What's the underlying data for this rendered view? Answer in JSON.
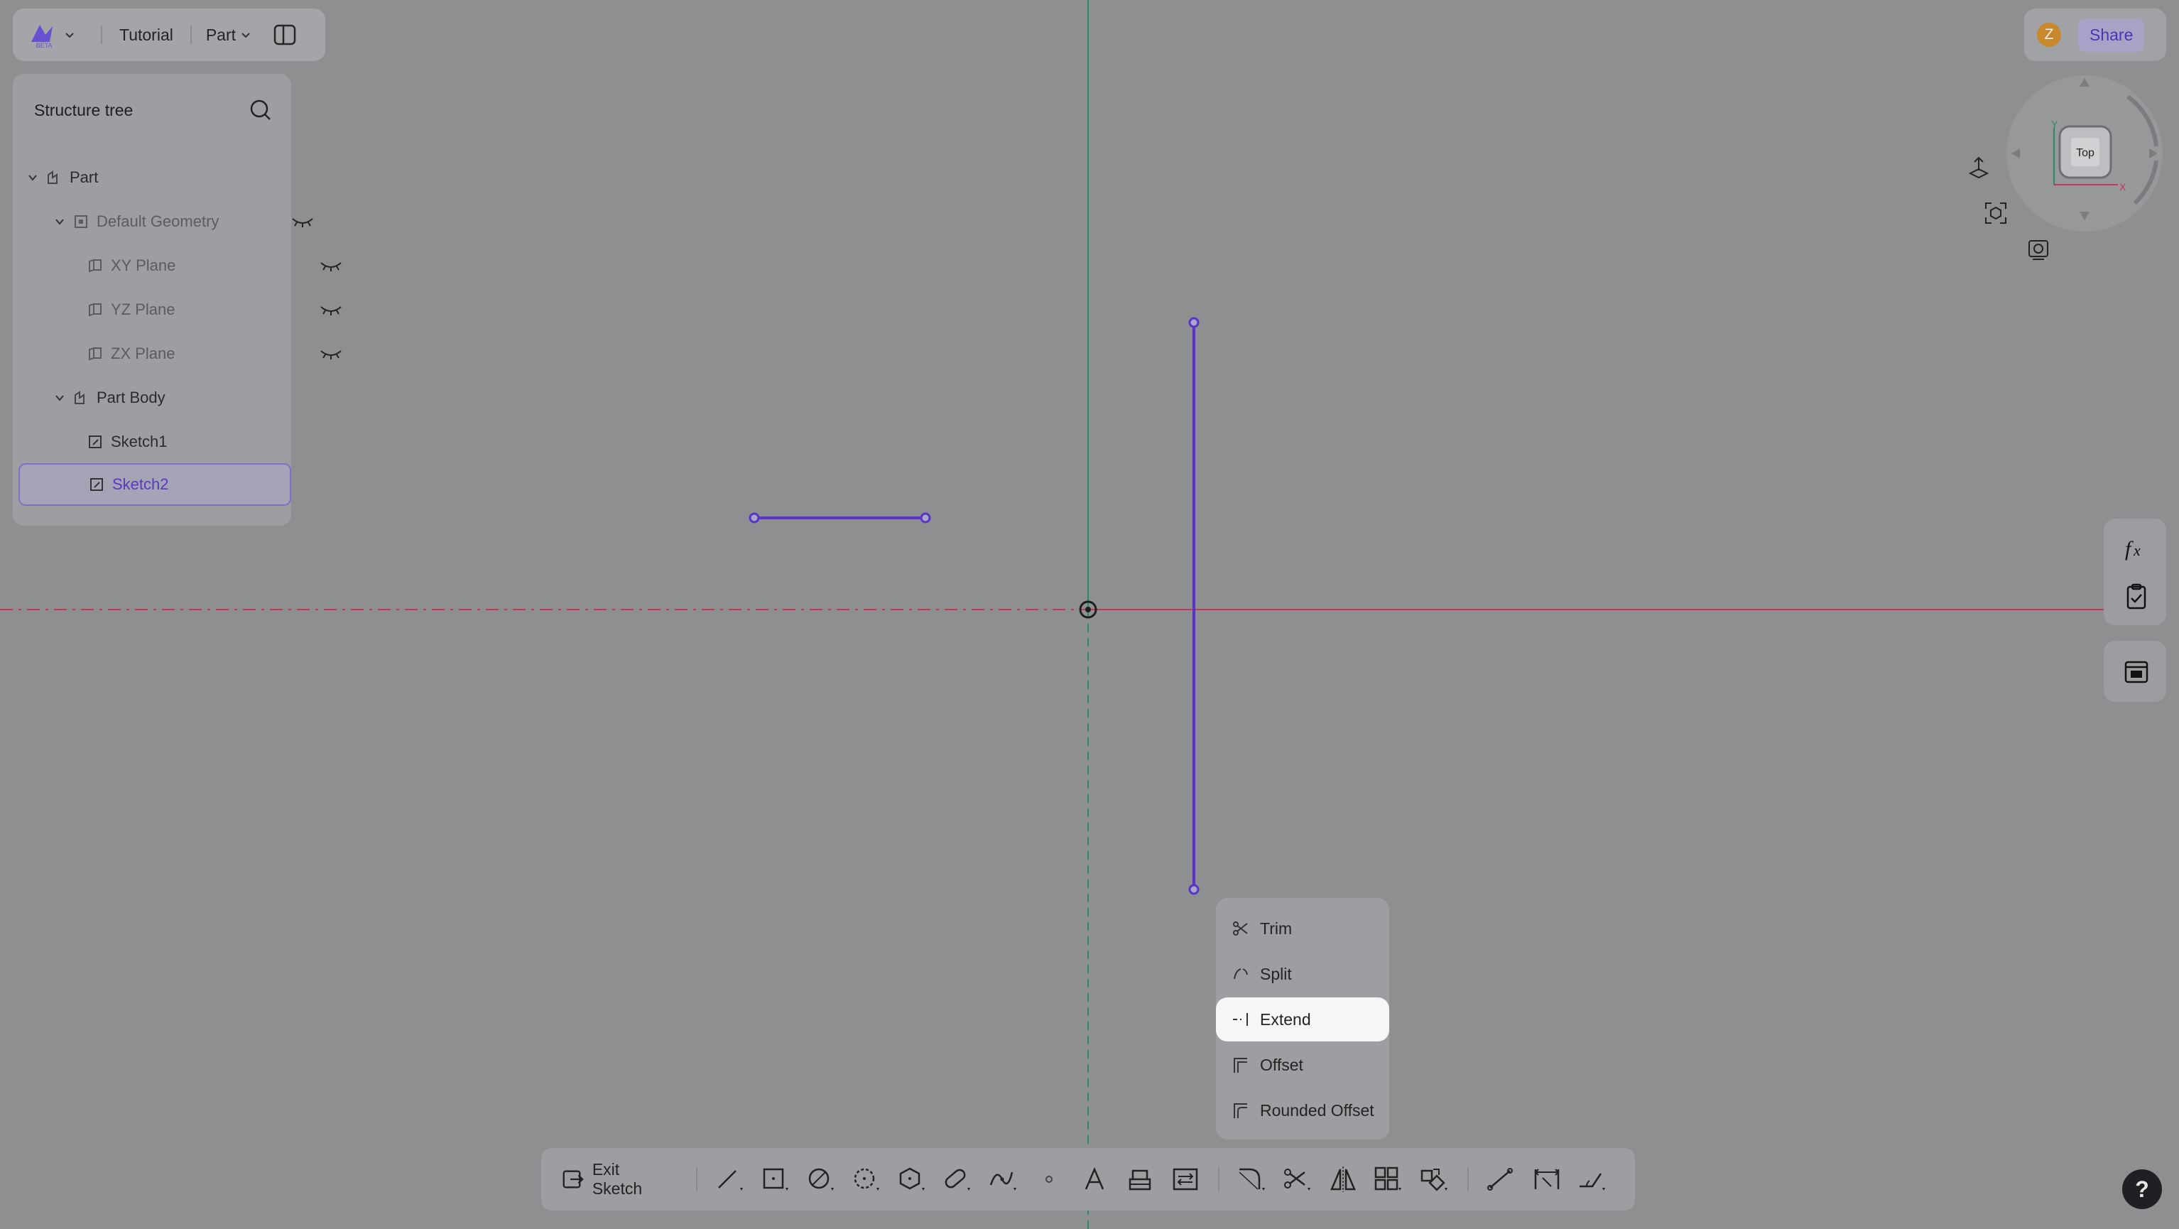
{
  "topbar": {
    "logo_badge": "BETA",
    "doc_title": "Tutorial",
    "mode_label": "Part"
  },
  "tree": {
    "title": "Structure tree",
    "items": [
      {
        "label": "Part",
        "level": 0,
        "expanded": true
      },
      {
        "label": "Default Geometry",
        "level": 1,
        "expanded": true,
        "hidden": true
      },
      {
        "label": "XY Plane",
        "level": 2,
        "hidden": true
      },
      {
        "label": "YZ Plane",
        "level": 2,
        "hidden": true
      },
      {
        "label": "ZX Plane",
        "level": 2,
        "hidden": true
      },
      {
        "label": "Part Body",
        "level": 1,
        "expanded": true
      },
      {
        "label": "Sketch1",
        "level": 2
      },
      {
        "label": "Sketch2",
        "level": 2,
        "selected": true
      }
    ]
  },
  "user": {
    "initial": "Z",
    "share_label": "Share"
  },
  "viewcube": {
    "face_label": "Top",
    "axis_y": "Y",
    "axis_x": "X"
  },
  "context_menu": {
    "items": [
      {
        "label": "Trim",
        "icon": "trim-icon"
      },
      {
        "label": "Split",
        "icon": "split-icon"
      },
      {
        "label": "Extend",
        "icon": "extend-icon",
        "active": true
      },
      {
        "label": "Offset",
        "icon": "offset-icon"
      },
      {
        "label": "Rounded Offset",
        "icon": "rounded-offset-icon"
      }
    ]
  },
  "bottom_toolbar": {
    "exit_label": "Exit Sketch"
  },
  "help": {
    "label": "?"
  },
  "colors": {
    "canvas": "#8e8f91",
    "sketch_line": "#5a34c8",
    "x_axis": "#c8345a",
    "y_axis": "#2a8a6c",
    "accent": "#5a38c4"
  }
}
